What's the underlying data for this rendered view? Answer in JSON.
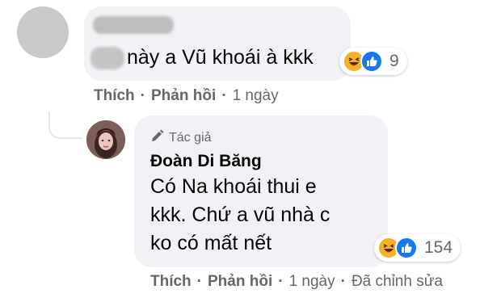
{
  "comment": {
    "text": "này a Vũ khoái à kkk",
    "reactions": {
      "icons": [
        "haha-icon",
        "like-icon"
      ],
      "count": "9"
    },
    "actions": {
      "like": "Thích",
      "reply": "Phản hồi",
      "time": "1 ngày",
      "separator": "·"
    }
  },
  "reply": {
    "badge": "Tác giả",
    "author": "Đoàn Di Băng",
    "lines": [
      "Có Na khoái thui e",
      "kkk. Chứ a vũ nhà c",
      "ko có mất nết"
    ],
    "reactions": {
      "icons": [
        "haha-icon",
        "like-icon"
      ],
      "count": "154"
    },
    "actions": {
      "like": "Thích",
      "reply": "Phản hồi",
      "time": "1 ngày",
      "edited": "Đã chỉnh sửa",
      "separator": "·"
    }
  },
  "colors": {
    "bubble": "#f0f2f5",
    "meta": "#65676b",
    "like": "#1877f2",
    "haha": "#f7b125"
  }
}
